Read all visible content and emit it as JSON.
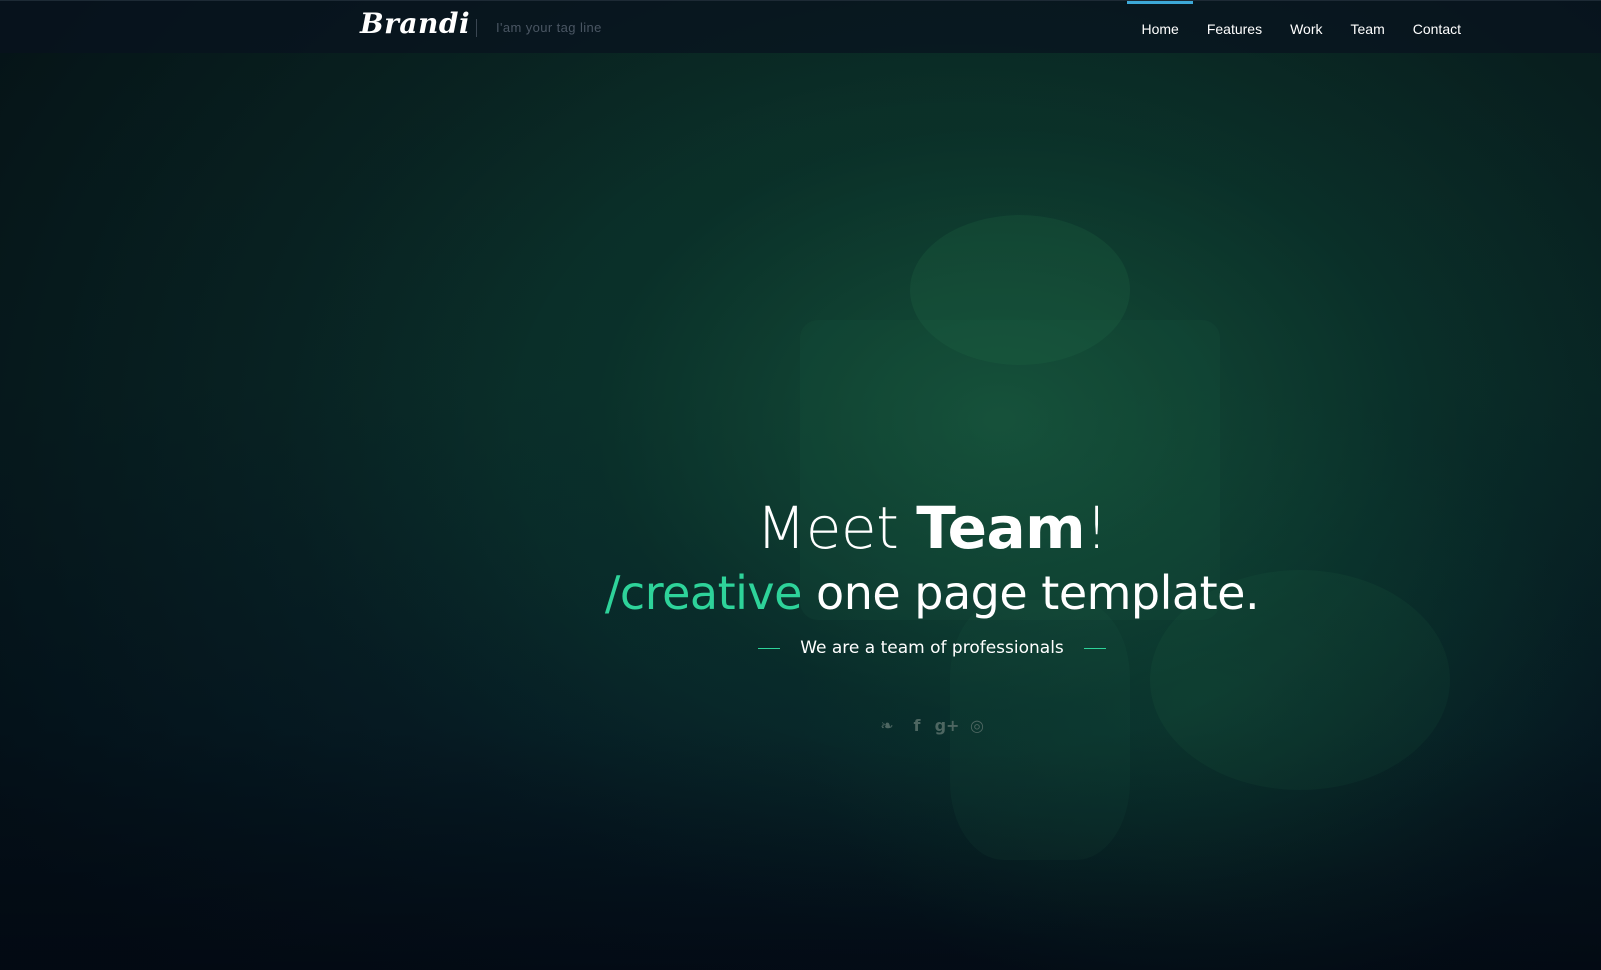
{
  "header": {
    "brand": "Brandi",
    "tagline": "I'am your tag line",
    "nav": [
      {
        "label": "Home",
        "active": true
      },
      {
        "label": "Features",
        "active": false
      },
      {
        "label": "Work",
        "active": false
      },
      {
        "label": "Team",
        "active": false
      },
      {
        "label": "Contact",
        "active": false
      }
    ]
  },
  "hero": {
    "headline_prefix": "Meet ",
    "headline_bold": "Team",
    "headline_suffix": "!",
    "sub_accent": "/creative",
    "sub_rest": " one page template.",
    "tagline": "We are a team of professionals",
    "social": [
      {
        "icon": "twitter-icon",
        "glyph": "❧"
      },
      {
        "icon": "facebook-icon",
        "glyph": "f"
      },
      {
        "icon": "google-plus-icon",
        "glyph": "g+"
      },
      {
        "icon": "dribbble-icon",
        "glyph": "◎"
      }
    ]
  },
  "colors": {
    "accent": "#2ed39a",
    "nav_active": "#3da9d8",
    "text": "#ffffff"
  }
}
